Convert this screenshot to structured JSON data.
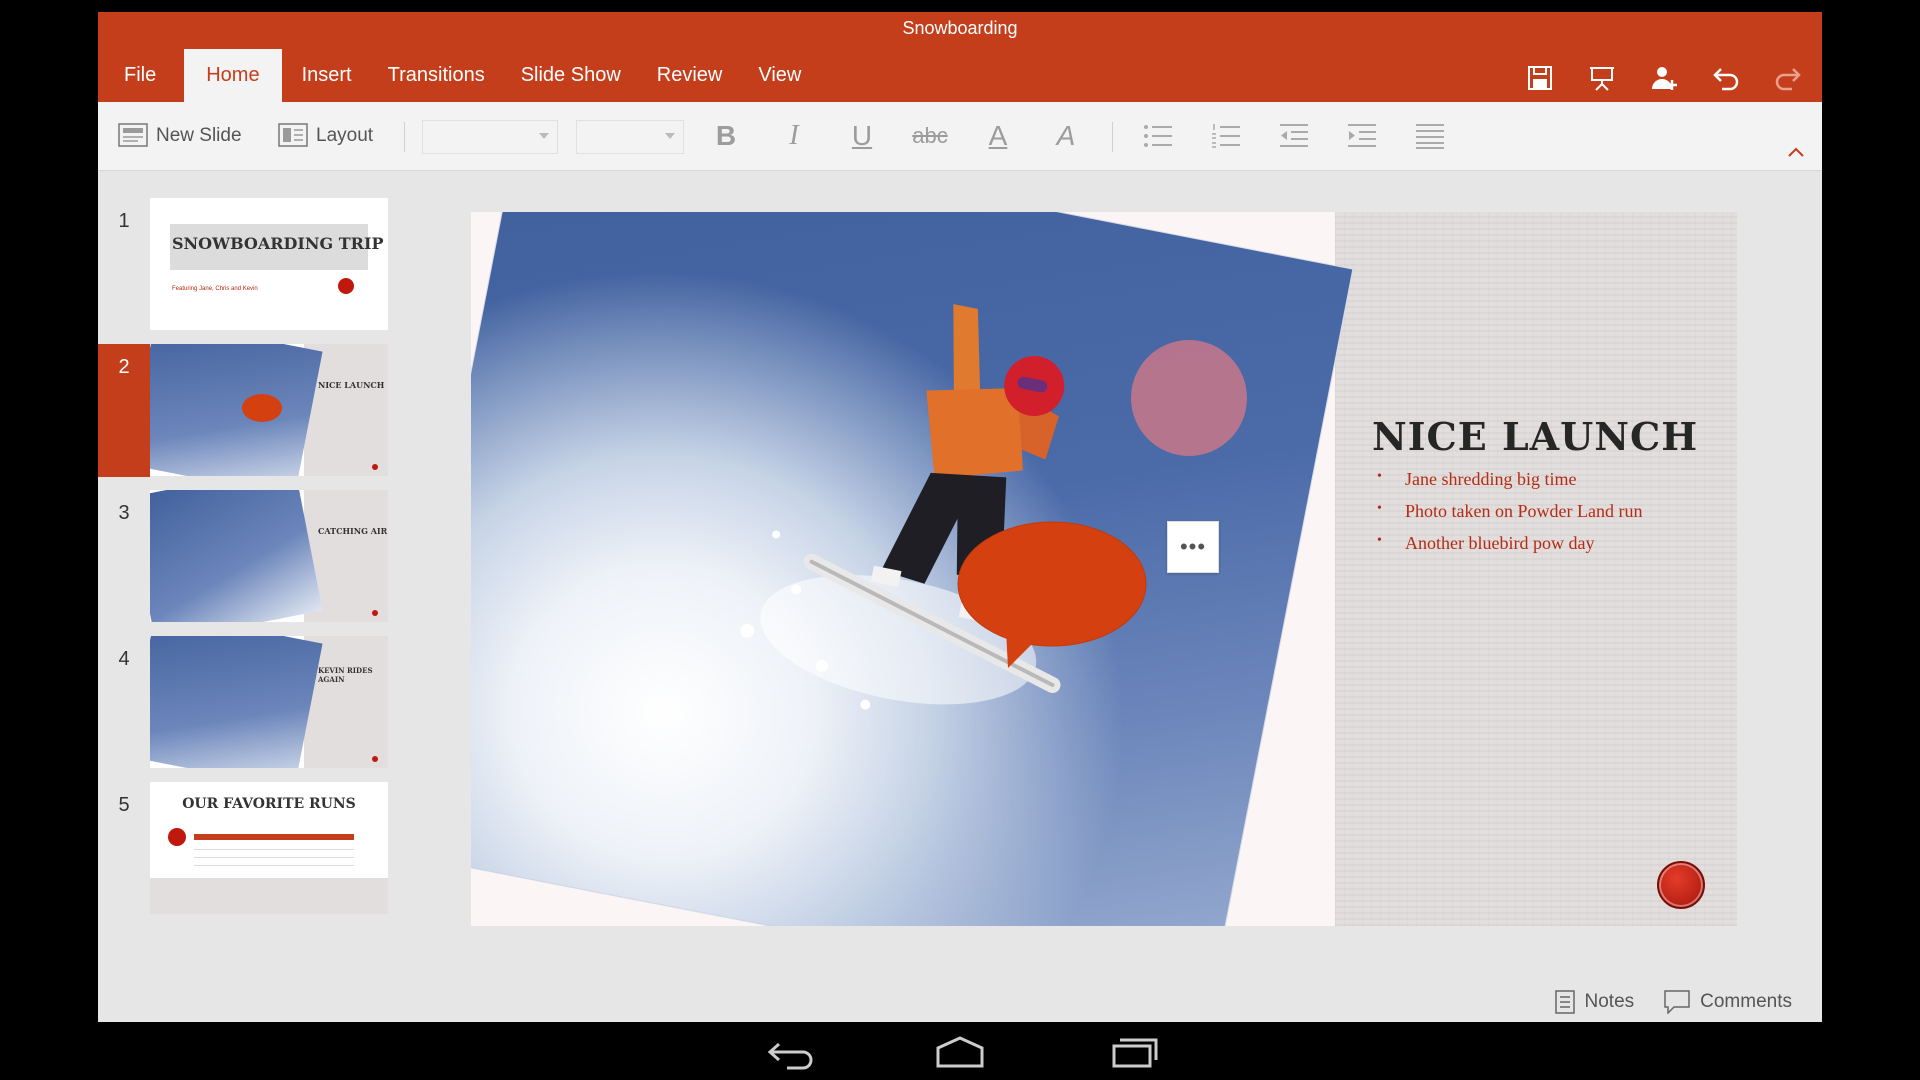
{
  "window": {
    "title": "Snowboarding"
  },
  "tabs": [
    "File",
    "Home",
    "Insert",
    "Transitions",
    "Slide Show",
    "Review",
    "View"
  ],
  "active_tab": "Home",
  "ribbon": {
    "new_slide": "New Slide",
    "layout": "Layout"
  },
  "thumbnails": [
    {
      "num": "1",
      "title": "SNOWBOARDING TRIP",
      "subtitle": "Featuring Jane, Chris and Kevin"
    },
    {
      "num": "2",
      "title": "NICE LAUNCH"
    },
    {
      "num": "3",
      "title": "CATCHING AIR"
    },
    {
      "num": "4",
      "title": "KEVIN RIDES AGAIN"
    },
    {
      "num": "5",
      "title": "OUR FAVORITE RUNS"
    }
  ],
  "selected_slide": "2",
  "slide": {
    "title": "NICE LAUNCH",
    "bullets": [
      "Jane shredding big time",
      "Photo taken on Powder Land run",
      "Another bluebird pow day"
    ],
    "more_label": "•••"
  },
  "status": {
    "notes": "Notes",
    "comments": "Comments"
  },
  "colors": {
    "accent": "#c43e1c",
    "bullet_text": "#b52a12",
    "bubble": "#d4400f"
  }
}
